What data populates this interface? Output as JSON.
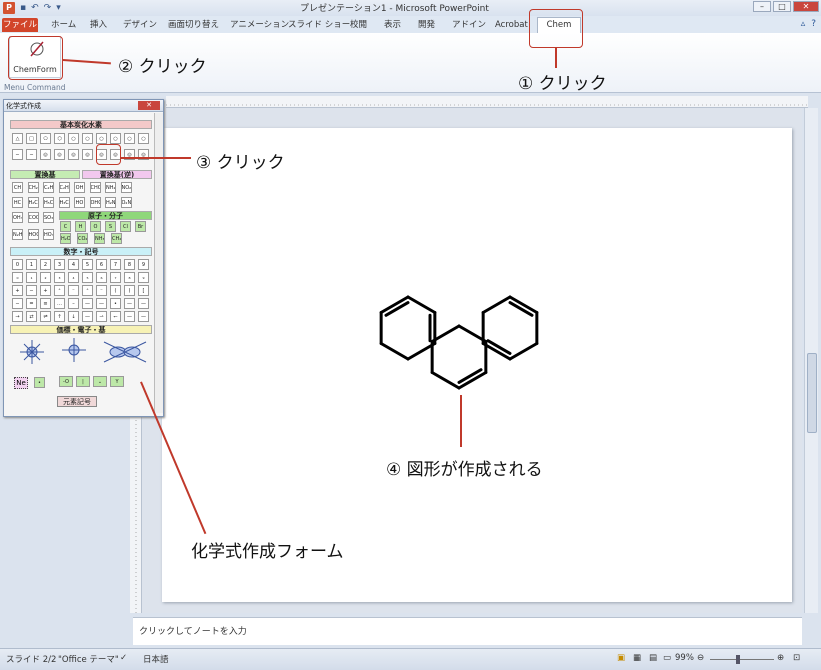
{
  "app": {
    "window_title": "プレゼンテーション1 - Microsoft PowerPoint",
    "qat_app_icon": "P"
  },
  "tabs": [
    "ファイル",
    "ホーム",
    "挿入",
    "デザイン",
    "画面切り替え",
    "アニメーション",
    "スライド ショー",
    "校閲",
    "表示",
    "開発",
    "アドイン",
    "Acrobat",
    "Chem"
  ],
  "ribbon": {
    "chemform_label": "ChemForm",
    "group_label": "Menu Command"
  },
  "annotations": {
    "step1": "① クリック",
    "step2": "② クリック",
    "step3": "③ クリック",
    "step4": "④ 図形が作成される",
    "form_label": "化学式作成フォーム"
  },
  "palette": {
    "title": "化学式作成",
    "sec_hydrocarbon": "基本炭化水素",
    "sec_substituent": "置換基",
    "sec_substituent_rev": "置換基(逆)",
    "sec_atom": "原子・分子",
    "sec_numbers": "数字・記号",
    "sec_valence": "価標・電子・基",
    "element_button": "元素記号",
    "ne_label": "Ne",
    "sub_row1": [
      "CH",
      "CH₂",
      "C₂H₅",
      "C₂H₃",
      "OH",
      "CHO",
      "NH₂",
      "NO₂"
    ],
    "sub_row2": [
      "HC",
      "H₂C",
      "H₅C₂",
      "H₃C₂",
      "HO",
      "OHC",
      "H₂N",
      "O₂N"
    ],
    "sub_row3": [
      "OH₃N",
      "COOH",
      "SO₃H"
    ],
    "sub_row4": [
      "N₂H₃N",
      "HOOC",
      "HO₃S"
    ],
    "atom_row1": [
      "C",
      "H",
      "O",
      "S",
      "Cl",
      "Br"
    ],
    "atom_row2": [
      "H₂O",
      "CO₂",
      "NH₃",
      "CH₄"
    ],
    "num_row1": [
      "0",
      "1",
      "2",
      "3",
      "4",
      "5",
      "6",
      "7",
      "8",
      "9"
    ],
    "num_row2": [
      "₀",
      "₁",
      "₂",
      "₃",
      "₄",
      "₅",
      "₆",
      "₇",
      "₈",
      "₉"
    ],
    "num_row3": [
      "+",
      "−",
      "+",
      "⁺",
      "⁻",
      "⁺",
      "⁻",
      "(",
      ")",
      "["
    ],
    "num_row4": [
      "−",
      "=",
      "≡",
      "…",
      "–",
      "—",
      "—",
      "•",
      "—",
      "—"
    ],
    "num_row5": [
      "→",
      "⇄",
      "⇌",
      "↑",
      "↓",
      "—",
      "⇀",
      "↽",
      "—",
      "—"
    ]
  },
  "notes_placeholder": "クリックしてノートを入力",
  "status": {
    "slide": "スライド 2/2",
    "theme": "\"Office テーマ\"",
    "language": "日本語",
    "zoom": "99%"
  },
  "molecule": {
    "name": "phenanthrene"
  }
}
